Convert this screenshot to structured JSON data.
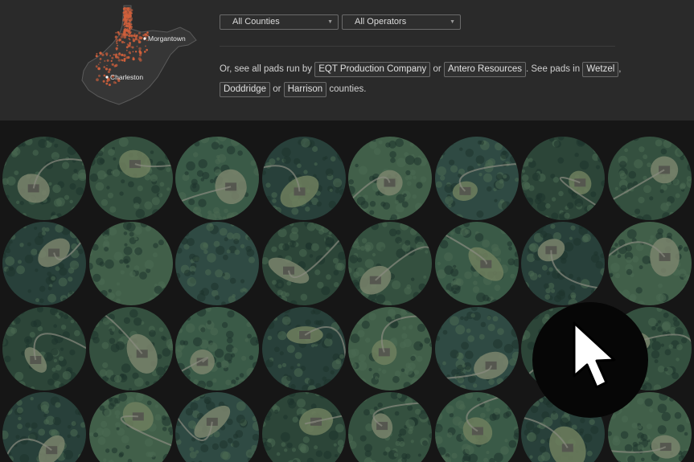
{
  "map": {
    "cities": [
      "Morgantown",
      "Charleston"
    ],
    "outline_color": "#5a5a5a",
    "dot_color": "#d0603c"
  },
  "filters": {
    "counties": {
      "selected": "All Counties",
      "icon": "caret-down-icon"
    },
    "operators": {
      "selected": "All Operators",
      "icon": "caret-down-icon"
    }
  },
  "suggest": {
    "prefix": "Or, see all pads run by",
    "operator_1": "EQT Production Company",
    "or_1": "or",
    "operator_2": "Antero Resources",
    "mid": ". See pads in",
    "county_1": "Wetzel",
    "comma": ",",
    "county_2": "Doddridge",
    "or_2": "or",
    "county_3": "Harrison",
    "suffix": "counties."
  },
  "pads": {
    "rows": 4,
    "columns": 8,
    "forest_color": "#2f4a3c",
    "clearing_color": "#7d8c6a"
  },
  "cursor": {
    "icon": "pointer-arrow-icon"
  }
}
